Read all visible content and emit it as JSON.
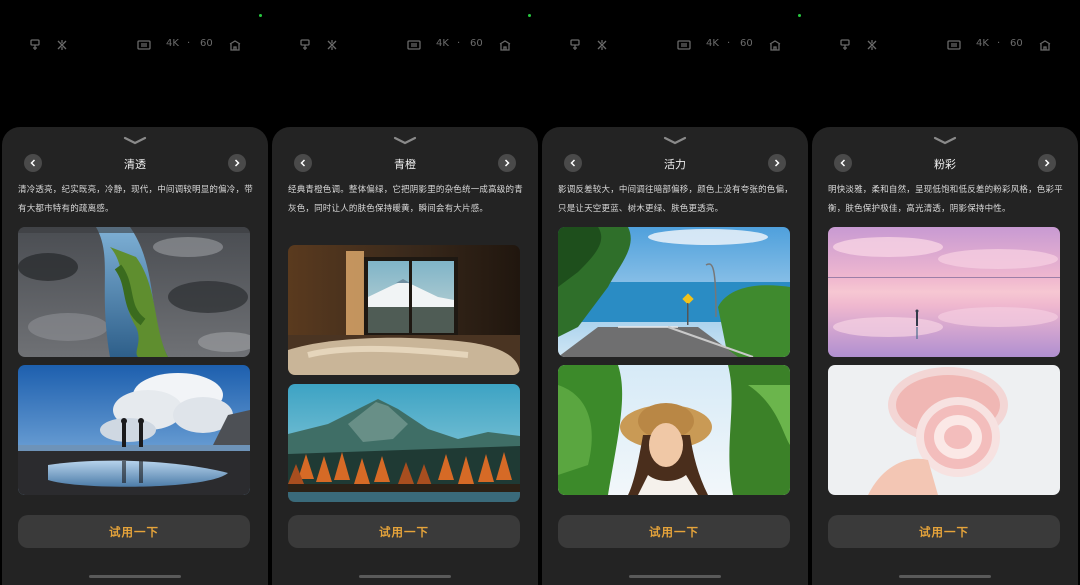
{
  "toolbar": {
    "resolution": "4K",
    "fps": "60",
    "separator": "·"
  },
  "try_label": "试用一下",
  "panels": [
    {
      "title": "清透",
      "description": "清冷透亮，纪实既亮，冷静，现代，中间调较明显的偏冷，带有大都市特有的疏离感。",
      "photos": [
        "street-reflection",
        "beach-silhouettes"
      ]
    },
    {
      "title": "青橙",
      "description": "经典青橙色调。整体偏绿，它把阴影里的杂色统一成高级的青灰色，同时让人的肤色保持暖黄，瞬间会有大片感。",
      "photos": [
        "bedroom-window",
        "mountain-forest"
      ]
    },
    {
      "title": "活力",
      "description": "影调反差较大，中间调往暗部偏移，颜色上没有夸张的色偏，只是让天空更蓝、树木更绿、肤色更透亮。",
      "photos": [
        "coastal-road",
        "girl-with-hat"
      ]
    },
    {
      "title": "粉彩",
      "description": "明快淡雅，柔和自然，呈现低饱和低反差的粉彩风格，色彩平衡，肤色保护极佳，高光清透，阴影保持中性。",
      "photos": [
        "pink-salt-lake",
        "pink-cake-roll"
      ]
    }
  ],
  "colors": {
    "sheet": "#232323",
    "accent": "#e6a43a",
    "button": "#3a3a3a",
    "status_dot": "#27c93f"
  },
  "icons": [
    "flash-icon",
    "shutter-timer-icon",
    "hdr-icon",
    "settings-icon",
    "chevron-down-icon",
    "chevron-left-icon",
    "chevron-right-icon"
  ]
}
